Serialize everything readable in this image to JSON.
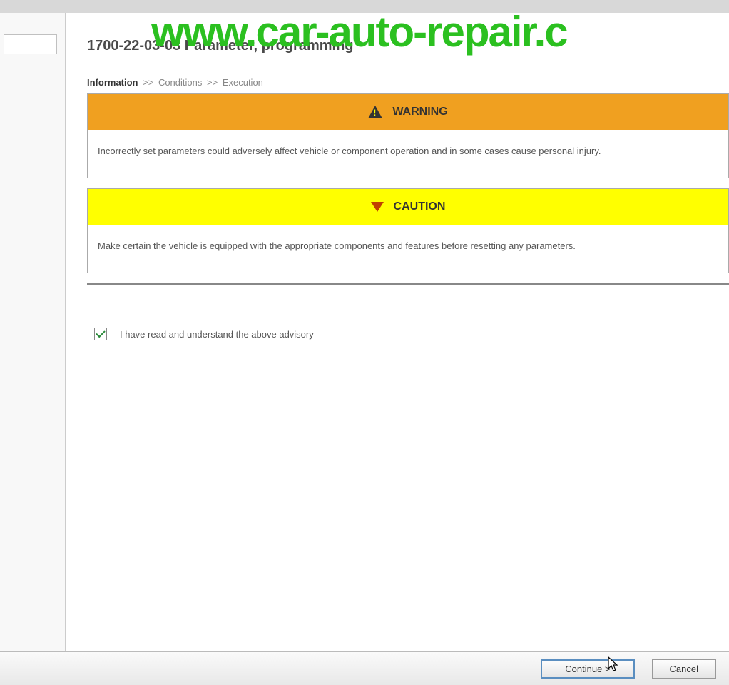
{
  "watermark": "www.car-auto-repair.c",
  "title": "1700-22-03-03 Parameter, programming",
  "breadcrumb": {
    "item1": "Information",
    "item2": "Conditions",
    "item3": "Execution",
    "sep": ">>"
  },
  "warning": {
    "header": "WARNING",
    "body": "Incorrectly set parameters could adversely affect vehicle or component operation and in some cases cause personal injury."
  },
  "caution": {
    "header": "CAUTION",
    "body": "Make certain the vehicle is equipped with the appropriate components and features before resetting any parameters."
  },
  "advisory": {
    "label": "I have read and understand the above advisory",
    "checked": true
  },
  "buttons": {
    "continue": "Continue >",
    "cancel": "Cancel"
  }
}
